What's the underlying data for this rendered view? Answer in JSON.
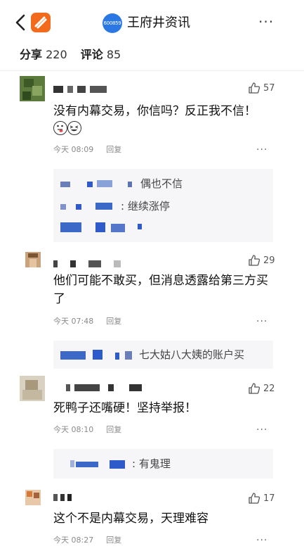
{
  "header": {
    "channel_badge": "600859",
    "channel_title": "王府井资讯",
    "more_label": "···"
  },
  "stats": {
    "share_label": "分享",
    "share_count": "220",
    "comment_label": "评论",
    "comment_count": "85"
  },
  "comments": [
    {
      "likes": "57",
      "text": "没有内幕交易，你信吗？反正我不信！",
      "time": "今天 08:09",
      "reply_label": "回复",
      "more": "···",
      "replies": [
        {
          "text": "偶也不信"
        },
        {
          "text": ": 继续涨停"
        }
      ]
    },
    {
      "likes": "29",
      "text": "他们可能不敢买，但消息透露给第三方买了",
      "time": "今天 07:48",
      "reply_label": "回复",
      "more": "···",
      "replies": [
        {
          "text": "七大姑八大姨的账户买"
        }
      ]
    },
    {
      "likes": "22",
      "text": "死鸭子还嘴硬！坚持举报！",
      "time": "今天 08:10",
      "reply_label": "回复",
      "more": "···",
      "replies": [
        {
          "text": ": 有鬼理"
        }
      ]
    },
    {
      "likes": "17",
      "text": "这个不是内幕交易，天理难容",
      "time": "今天 08:27",
      "reply_label": "回复",
      "more": "···"
    }
  ]
}
